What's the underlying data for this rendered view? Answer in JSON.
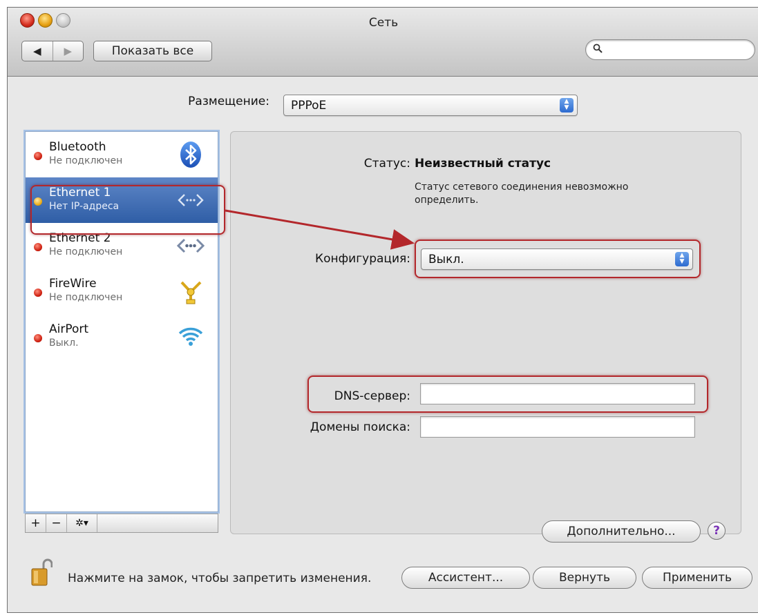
{
  "window": {
    "title": "Сеть"
  },
  "toolbar": {
    "back": "◀",
    "forward": "▶",
    "show_all": "Показать все",
    "search_placeholder": ""
  },
  "location": {
    "label": "Размещение:",
    "value": "PPPoE"
  },
  "services": [
    {
      "name": "Bluetooth",
      "status": "Не подключен",
      "dot": "red",
      "icon": "bluetooth-icon"
    },
    {
      "name": "Ethernet 1",
      "status": "Нет IP-адреса",
      "dot": "yellow",
      "icon": "ethernet-icon"
    },
    {
      "name": "Ethernet 2",
      "status": "Не подключен",
      "dot": "red",
      "icon": "ethernet-icon"
    },
    {
      "name": "FireWire",
      "status": "Не подключен",
      "dot": "red",
      "icon": "firewire-icon"
    },
    {
      "name": "AirPort",
      "status": "Выкл.",
      "dot": "red",
      "icon": "wifi-icon"
    }
  ],
  "sidebar_buttons": {
    "add": "+",
    "remove": "−",
    "action": "✲▾"
  },
  "detail": {
    "status_label": "Статус:",
    "status_value": "Неизвестный статус",
    "status_desc": "Статус сетевого соединения невозможно определить.",
    "config_label": "Конфигурация:",
    "config_value": "Выкл.",
    "dns_label": "DNS-сервер:",
    "dns_value": "",
    "search_domains_label": "Домены поиска:",
    "search_domains_value": "",
    "advanced": "Дополнительно...",
    "help": "?"
  },
  "footer": {
    "lock_message": "Нажмите на замок, чтобы запретить изменения.",
    "assistant": "Ассистент...",
    "revert": "Вернуть",
    "apply": "Применить"
  },
  "colors": {
    "selection": "#3a68b0",
    "highlight": "#b3272b",
    "status_red": "#cc1d0d",
    "status_yellow": "#e9a812"
  }
}
